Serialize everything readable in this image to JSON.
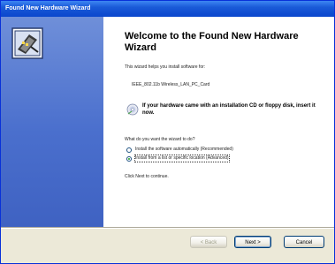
{
  "window": {
    "title": "Found New Hardware Wizard"
  },
  "main": {
    "heading": "Welcome to the Found New Hardware Wizard",
    "intro": "This wizard helps you install software for:",
    "device_name": "IEEE_802.11b Wireless_LAN_PC_Card",
    "cd_instruction": "If your hardware came with an installation CD or floppy disk, insert it now.",
    "question": "What do you want the wizard to do?",
    "options": [
      {
        "label": "Install the software automatically (Recommended)",
        "selected": false
      },
      {
        "label": "Install from a list or specific location (Advanced)",
        "selected": true
      }
    ],
    "continue_hint": "Click Next to continue."
  },
  "buttons": {
    "back": "< Back",
    "next": "Next >",
    "cancel": "Cancel"
  },
  "colors": {
    "titlebar": "#0a46cc",
    "sidebar": "#4a6fcd",
    "window_bg": "#ece9d8"
  }
}
